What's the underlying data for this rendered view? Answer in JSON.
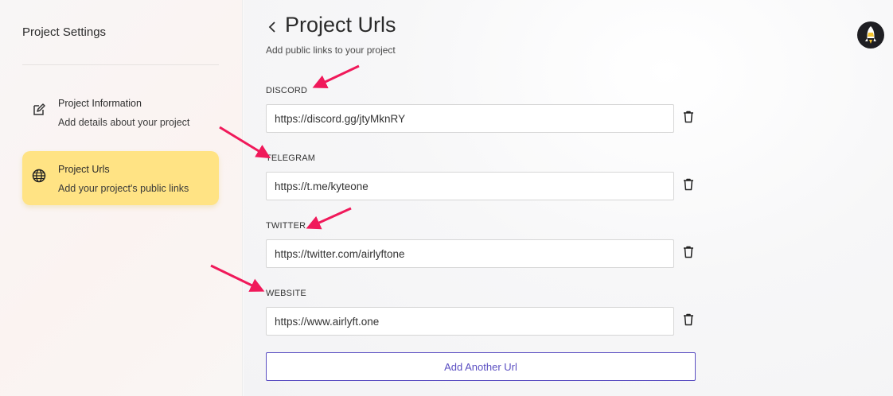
{
  "sidebar": {
    "title": "Project Settings",
    "items": [
      {
        "title": "Project Information",
        "subtitle": "Add details about your project",
        "icon": "edit-icon",
        "active": false
      },
      {
        "title": "Project Urls",
        "subtitle": "Add your project's public links",
        "icon": "globe-icon",
        "active": true
      }
    ]
  },
  "header": {
    "back_icon": "chevron-left-icon",
    "title": "Project Urls",
    "subtitle": "Add public links to your project"
  },
  "fields": [
    {
      "label": "DISCORD",
      "value": "https://discord.gg/jtyMknRY"
    },
    {
      "label": "TELEGRAM",
      "value": "https://t.me/kyteone"
    },
    {
      "label": "TWITTER",
      "value": "https://twitter.com/airlyftone"
    },
    {
      "label": "WEBSITE",
      "value": "https://www.airlyft.one"
    }
  ],
  "add_button_label": "Add Another Url",
  "avatar": {
    "icon": "rocket-avatar-icon"
  },
  "colors": {
    "active_nav": "#ffe384",
    "accent": "#5b4fc2",
    "annotation_arrow": "#f0195a"
  }
}
